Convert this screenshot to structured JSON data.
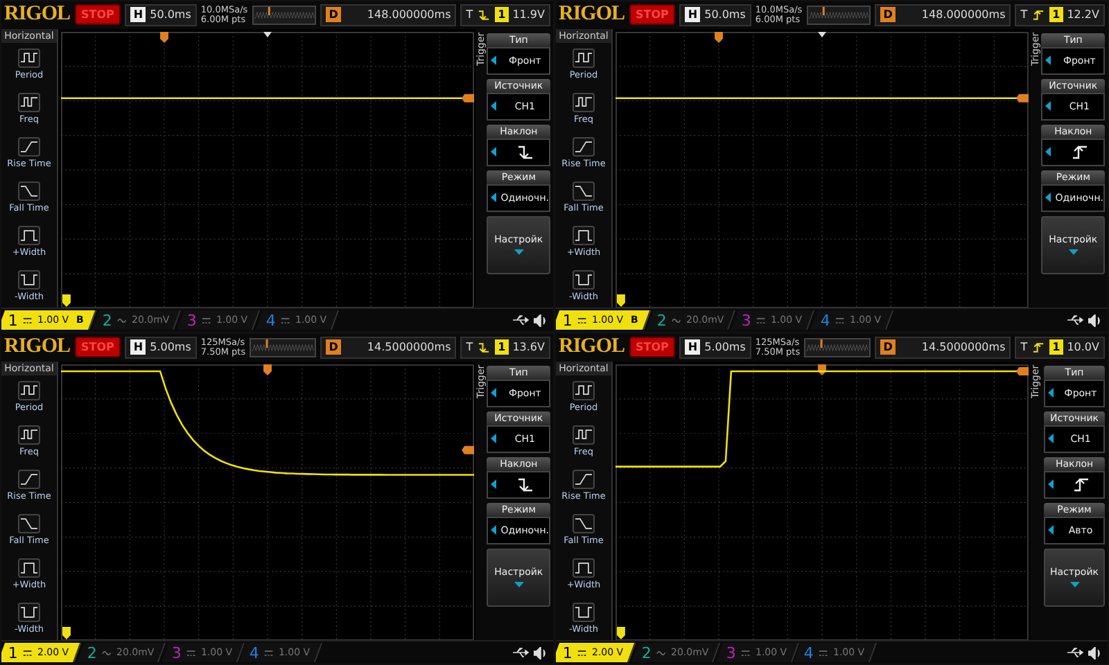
{
  "scopes": [
    {
      "logo": "RIGOL",
      "run_status": "STOP",
      "timebase_label": "H",
      "timebase": "50.0ms",
      "sample_rate": "10.0MSa/s",
      "memory_depth": "6.00M pts",
      "memory_view": {
        "level": 0.25
      },
      "delay_label": "D",
      "delay": "148.000000ms",
      "trigger": {
        "label": "T",
        "falling": true,
        "source": "1",
        "level": "11.9V"
      },
      "trigger_marker": {
        "level": 0.25
      },
      "trace": {
        "kind": "flat"
      },
      "measure_menu": {
        "title": "Horizontal",
        "items": [
          {
            "label": "Period",
            "kind": "period"
          },
          {
            "label": "Freq",
            "kind": "freq"
          },
          {
            "label": "Rise Time",
            "kind": "rise"
          },
          {
            "label": "Fall Time",
            "kind": "fall"
          },
          {
            "label": "+Width",
            "kind": "pwidth"
          },
          {
            "label": "-Width",
            "kind": "nwidth"
          }
        ]
      },
      "trigger_menu": {
        "title": "Trigger",
        "items": [
          {
            "heading": "Тип",
            "kind": "value",
            "value": "Фронт"
          },
          {
            "heading": "Источник",
            "kind": "value",
            "value": "CH1"
          },
          {
            "heading": "Наклон",
            "kind": "slope",
            "falling": true
          },
          {
            "heading": "Режим",
            "kind": "value",
            "value": "Одиночн."
          },
          {
            "heading": "Настройк",
            "kind": "more"
          }
        ]
      },
      "channels": [
        {
          "number": "1",
          "ac": false,
          "scale": "1.00 V",
          "bandwidth_limit": "B",
          "active": true,
          "color": "#f0e010"
        },
        {
          "number": "2",
          "ac": true,
          "scale": "20.0mV",
          "active": false,
          "color": "#10b0a0"
        },
        {
          "number": "3",
          "ac": false,
          "scale": "1.00 V",
          "active": false,
          "color": "#c020c0"
        },
        {
          "number": "4",
          "ac": false,
          "scale": "1.00 V",
          "active": false,
          "color": "#2080e0"
        }
      ]
    },
    {
      "logo": "RIGOL",
      "run_status": "STOP",
      "timebase_label": "H",
      "timebase": "50.0ms",
      "sample_rate": "10.0MSa/s",
      "memory_depth": "6.00M pts",
      "memory_view": {
        "level": 0.25
      },
      "delay_label": "D",
      "delay": "148.000000ms",
      "trigger": {
        "label": "T",
        "falling": false,
        "source": "1",
        "level": "12.2V"
      },
      "trigger_marker": {
        "level": 0.25
      },
      "trace": {
        "kind": "flat"
      },
      "measure_menu": {
        "title": "Horizontal",
        "items": [
          {
            "label": "Period",
            "kind": "period"
          },
          {
            "label": "Freq",
            "kind": "freq"
          },
          {
            "label": "Rise Time",
            "kind": "rise"
          },
          {
            "label": "Fall Time",
            "kind": "fall"
          },
          {
            "label": "+Width",
            "kind": "pwidth"
          },
          {
            "label": "-Width",
            "kind": "nwidth"
          }
        ]
      },
      "trigger_menu": {
        "title": "Trigger",
        "items": [
          {
            "heading": "Тип",
            "kind": "value",
            "value": "Фронт"
          },
          {
            "heading": "Источник",
            "kind": "value",
            "value": "CH1"
          },
          {
            "heading": "Наклон",
            "kind": "slope",
            "falling": false
          },
          {
            "heading": "Режим",
            "kind": "value",
            "value": "Одиночн."
          },
          {
            "heading": "Настройк",
            "kind": "more"
          }
        ]
      },
      "channels": [
        {
          "number": "1",
          "ac": false,
          "scale": "1.00 V",
          "bandwidth_limit": "B",
          "active": true,
          "color": "#f0e010"
        },
        {
          "number": "2",
          "ac": true,
          "scale": "20.0mV",
          "active": false,
          "color": "#10b0a0"
        },
        {
          "number": "3",
          "ac": false,
          "scale": "1.00 V",
          "active": false,
          "color": "#c020c0"
        },
        {
          "number": "4",
          "ac": false,
          "scale": "1.00 V",
          "active": false,
          "color": "#2080e0"
        }
      ]
    },
    {
      "logo": "RIGOL",
      "run_status": "STOP",
      "timebase_label": "H",
      "timebase": "5.00ms",
      "sample_rate": "125MSa/s",
      "memory_depth": "7.50M pts",
      "memory_view": {
        "level": 0.25
      },
      "delay_label": "D",
      "delay": "14.5000000ms",
      "trigger": {
        "label": "T",
        "falling": true,
        "source": "1",
        "level": "13.6V"
      },
      "trigger_marker": {
        "level": 0.5
      },
      "trace": {
        "kind": "fall"
      },
      "measure_menu": {
        "title": "Horizontal",
        "items": [
          {
            "label": "Period",
            "kind": "period"
          },
          {
            "label": "Freq",
            "kind": "freq"
          },
          {
            "label": "Rise Time",
            "kind": "rise"
          },
          {
            "label": "Fall Time",
            "kind": "fall"
          },
          {
            "label": "+Width",
            "kind": "pwidth"
          },
          {
            "label": "-Width",
            "kind": "nwidth"
          }
        ]
      },
      "trigger_menu": {
        "title": "Trigger",
        "items": [
          {
            "heading": "Тип",
            "kind": "value",
            "value": "Фронт"
          },
          {
            "heading": "Источник",
            "kind": "value",
            "value": "CH1"
          },
          {
            "heading": "Наклон",
            "kind": "slope",
            "falling": true
          },
          {
            "heading": "Режим",
            "kind": "value",
            "value": "Одиночн."
          },
          {
            "heading": "Настройк",
            "kind": "more"
          }
        ]
      },
      "channels": [
        {
          "number": "1",
          "ac": false,
          "scale": "2.00 V",
          "active": true,
          "color": "#f0e010"
        },
        {
          "number": "2",
          "ac": true,
          "scale": "20.0mV",
          "active": false,
          "color": "#10b0a0"
        },
        {
          "number": "3",
          "ac": false,
          "scale": "1.00 V",
          "active": false,
          "color": "#c020c0"
        },
        {
          "number": "4",
          "ac": false,
          "scale": "1.00 V",
          "active": false,
          "color": "#2080e0"
        }
      ]
    },
    {
      "logo": "RIGOL",
      "run_status": "STOP",
      "timebase_label": "H",
      "timebase": "5.00ms",
      "sample_rate": "125MSa/s",
      "memory_depth": "7.50M pts",
      "memory_view": {
        "level": 0.25
      },
      "delay_label": "D",
      "delay": "14.5000000ms",
      "trigger": {
        "label": "T",
        "falling": false,
        "source": "1",
        "level": "10.0V"
      },
      "trigger_marker": {
        "level": 0.5
      },
      "trace": {
        "kind": "rise"
      },
      "measure_menu": {
        "title": "Horizontal",
        "items": [
          {
            "label": "Period",
            "kind": "period"
          },
          {
            "label": "Freq",
            "kind": "freq"
          },
          {
            "label": "Rise Time",
            "kind": "rise"
          },
          {
            "label": "Fall Time",
            "kind": "fall"
          },
          {
            "label": "+Width",
            "kind": "pwidth"
          },
          {
            "label": "-Width",
            "kind": "nwidth"
          }
        ]
      },
      "trigger_menu": {
        "title": "Trigger",
        "items": [
          {
            "heading": "Тип",
            "kind": "value",
            "value": "Фронт"
          },
          {
            "heading": "Источник",
            "kind": "value",
            "value": "CH1"
          },
          {
            "heading": "Наклон",
            "kind": "slope",
            "falling": false
          },
          {
            "heading": "Режим",
            "kind": "value",
            "value": "Авто"
          },
          {
            "heading": "Настройк",
            "kind": "more"
          }
        ]
      },
      "channels": [
        {
          "number": "1",
          "ac": false,
          "scale": "2.00 V",
          "active": true,
          "color": "#f0e010"
        },
        {
          "number": "2",
          "ac": true,
          "scale": "20.0mV",
          "active": false,
          "color": "#10b0a0"
        },
        {
          "number": "3",
          "ac": false,
          "scale": "1.00 V",
          "active": false,
          "color": "#c020c0"
        },
        {
          "number": "4",
          "ac": false,
          "scale": "1.00 V",
          "active": false,
          "color": "#2080e0"
        }
      ]
    }
  ]
}
